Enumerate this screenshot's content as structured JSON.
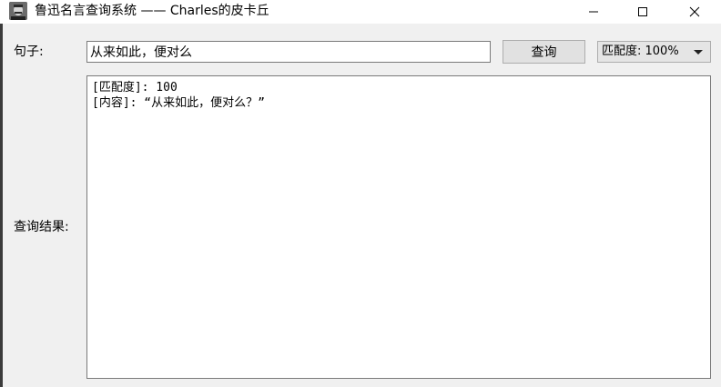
{
  "window": {
    "title": "鲁迅名言查询系统 —— Charles的皮卡丘",
    "icon": "lu-xun-portrait-icon"
  },
  "form": {
    "sentence_label": "句子:",
    "sentence_value": "从来如此，便对么",
    "query_button_label": "查询",
    "match_select_value": "匹配度: 100%",
    "result_label": "查询结果:"
  },
  "result": {
    "lines": [
      "[匹配度]: 100",
      "[内容]: “从来如此，便对么？”"
    ]
  }
}
